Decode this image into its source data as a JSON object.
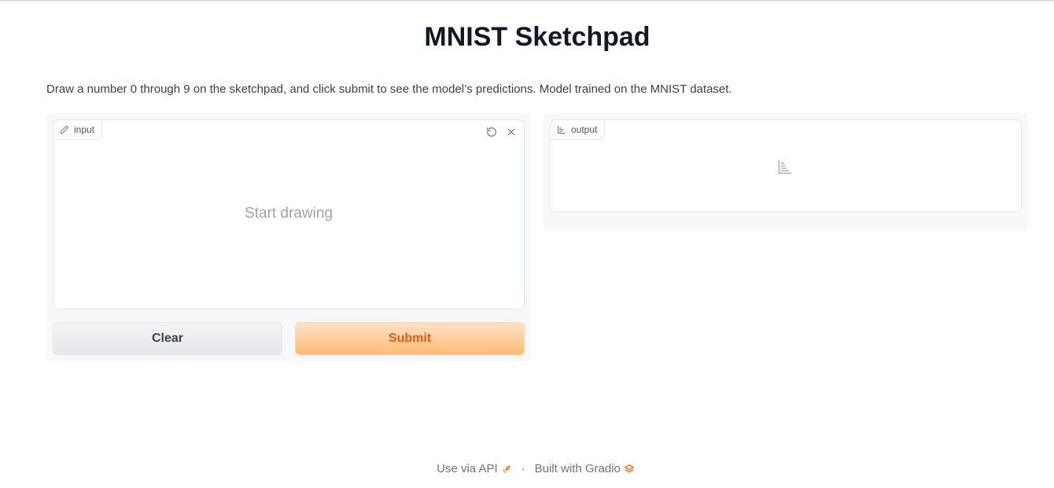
{
  "page": {
    "title": "MNIST Sketchpad",
    "description": "Draw a number 0 through 9 on the sketchpad, and click submit to see the model’s predictions. Model trained on the MNIST dataset."
  },
  "input": {
    "label": "input",
    "placeholder": "Start drawing",
    "icons": [
      "pencil-icon",
      "undo-icon",
      "close-icon"
    ]
  },
  "output": {
    "label": "output",
    "icons": [
      "bar-chart-icon"
    ]
  },
  "buttons": {
    "clear": "Clear",
    "submit": "Submit"
  },
  "footer": {
    "api_link": "Use via API",
    "separator": "·",
    "built_with": "Built with Gradio"
  },
  "colors": {
    "accent": "#ea580c",
    "submit_bg": "#fdba74"
  }
}
